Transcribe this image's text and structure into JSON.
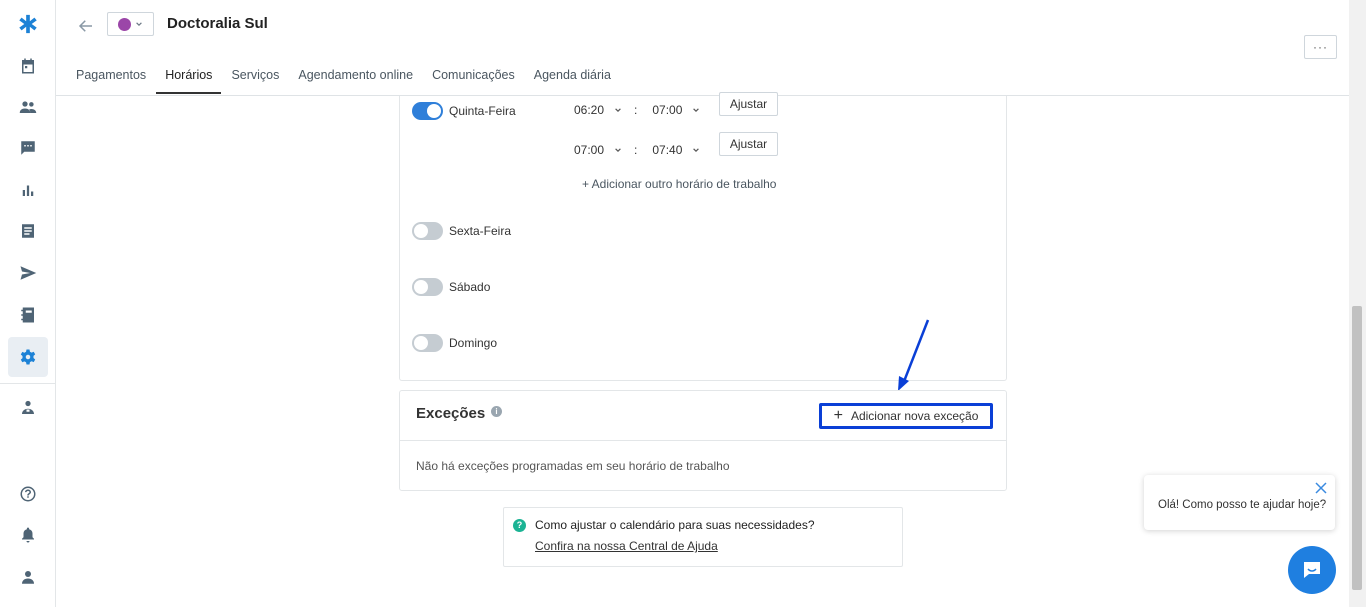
{
  "app": {
    "title": "Doctoralia Sul",
    "accent_color": "#2f7fd9",
    "calendar_color": "#9b46a8",
    "more_label": "···"
  },
  "sidebar": {
    "items": [
      {
        "name": "logo-icon"
      },
      {
        "name": "calendar-icon"
      },
      {
        "name": "patients-icon"
      },
      {
        "name": "messages-icon"
      },
      {
        "name": "reports-icon"
      },
      {
        "name": "list-icon"
      },
      {
        "name": "send-icon"
      },
      {
        "name": "notebook-icon"
      },
      {
        "name": "settings-icon",
        "active": true
      },
      {
        "name": "doctor-icon"
      },
      {
        "name": "help-icon"
      },
      {
        "name": "bell-icon"
      },
      {
        "name": "user-icon"
      }
    ]
  },
  "tabs": [
    {
      "label": "Pagamentos"
    },
    {
      "label": "Horários",
      "active": true
    },
    {
      "label": "Serviços"
    },
    {
      "label": "Agendamento online"
    },
    {
      "label": "Comunicações"
    },
    {
      "label": "Agenda diária"
    }
  ],
  "schedule": {
    "days": [
      {
        "label": "Quinta-Feira",
        "enabled": true
      },
      {
        "label": "Sexta-Feira",
        "enabled": false
      },
      {
        "label": "Sábado",
        "enabled": false
      },
      {
        "label": "Domingo",
        "enabled": false
      }
    ],
    "thursday_slots": [
      {
        "start": "06:20",
        "end": "07:00",
        "button": "Ajustar"
      },
      {
        "start": "07:00",
        "end": "07:40",
        "button": "Ajustar"
      }
    ],
    "separator": ":",
    "add_other": "+ Adicionar outro horário de trabalho"
  },
  "exceptions": {
    "title": "Exceções",
    "info_glyph": "i",
    "add_button": "Adicionar nova exceção",
    "add_glyph": "+",
    "empty_text": "Não há exceções programadas em seu horário de trabalho"
  },
  "help": {
    "glyph": "?",
    "question": "Como ajustar o calendário para suas necessidades?",
    "link": "Confira na nossa Central de Ajuda"
  },
  "chat": {
    "message": "Olá! Como posso te ajudar hoje?"
  }
}
